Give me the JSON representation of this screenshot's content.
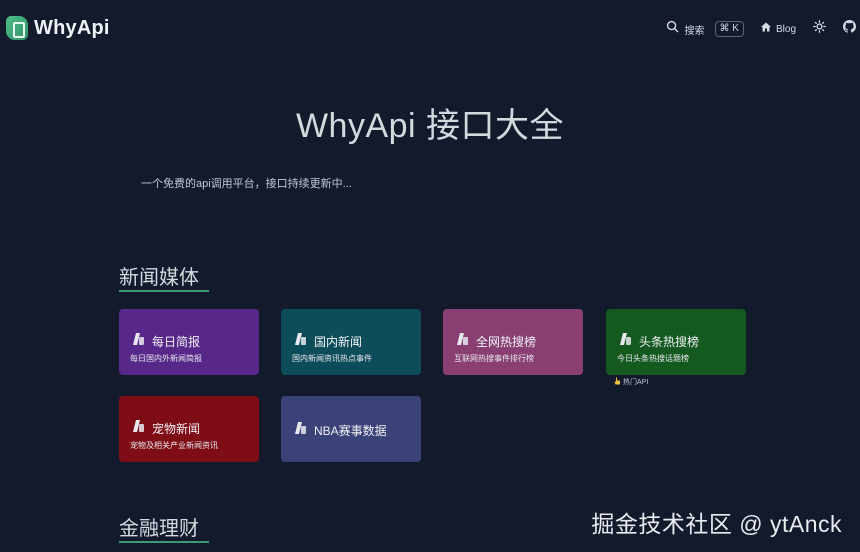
{
  "brand": {
    "name": "WhyApi"
  },
  "nav": {
    "search_label": "搜索",
    "shortcut": "⌘ K",
    "blog_label": "Blog"
  },
  "hero": {
    "title": "WhyApi 接口大全",
    "subtitle": "一个免费的api调用平台，接口持续更新中..."
  },
  "sections": [
    {
      "title": "新闻媒体",
      "cards": [
        {
          "title": "每日简报",
          "desc": "每日国内外新闻简报",
          "color": "#58278a"
        },
        {
          "title": "国内新闻",
          "desc": "国内新闻资讯热点事件",
          "color": "#0d4d5a"
        },
        {
          "title": "全网热搜榜",
          "desc": "互联网热搜事件排行榜",
          "color": "#8a3f72"
        },
        {
          "title": "头条热搜榜",
          "desc": "今日头条热搜话题榜",
          "color": "#14591f",
          "tag": "热门API"
        },
        {
          "title": "宠物新闻",
          "desc": "宠物及相关产业新闻资讯",
          "color": "#7e0d15"
        },
        {
          "title": "NBA赛事数据",
          "desc": "",
          "color": "#3b4278"
        }
      ]
    },
    {
      "title": "金融理财"
    }
  ],
  "watermark": "掘金技术社区 @ ytAnck",
  "colors": {
    "background": "#121a2c",
    "accent": "#3a9d72"
  },
  "icons": [
    "logo-icon",
    "search-icon",
    "home-icon",
    "sun-icon",
    "github-icon",
    "card-icon",
    "pointer-hand-icon"
  ]
}
